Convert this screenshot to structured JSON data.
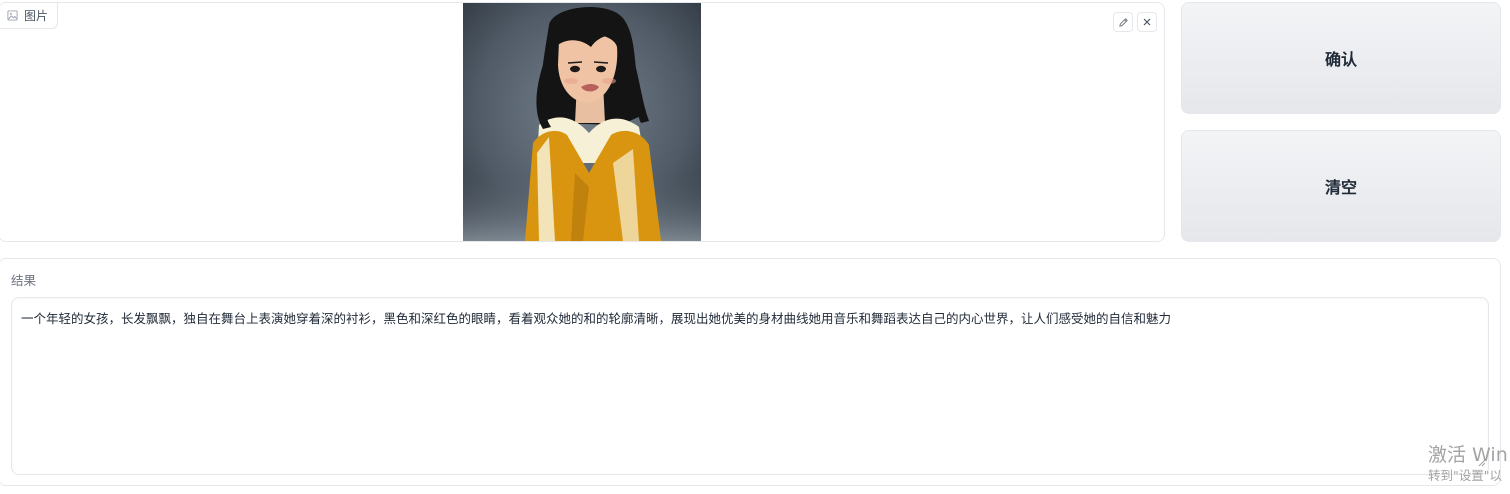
{
  "image_panel": {
    "label": "图片",
    "label_icon": "image-icon",
    "edit_icon": "pencil-icon",
    "close_icon": "close-icon",
    "artwork": "illustration-girl-yellow-shirt"
  },
  "actions": {
    "confirm_label": "确认",
    "clear_label": "清空"
  },
  "result": {
    "label": "结果",
    "text": "一个年轻的女孩，长发飘飘，独自在舞台上表演她穿着深的衬衫，黑色和深红色的眼睛，看着观众她的和的轮廓清晰，展现出她优美的身材曲线她用音乐和舞蹈表达自己的内心世界，让人们感受她的自信和魅力"
  },
  "watermark": {
    "title": "激活 Win",
    "subtitle": "转到\"设置\"以"
  },
  "colors": {
    "button_bg": "#e5e7eb",
    "border": "#e5e7eb",
    "shirt": "#d9950f",
    "hair": "#151515"
  }
}
